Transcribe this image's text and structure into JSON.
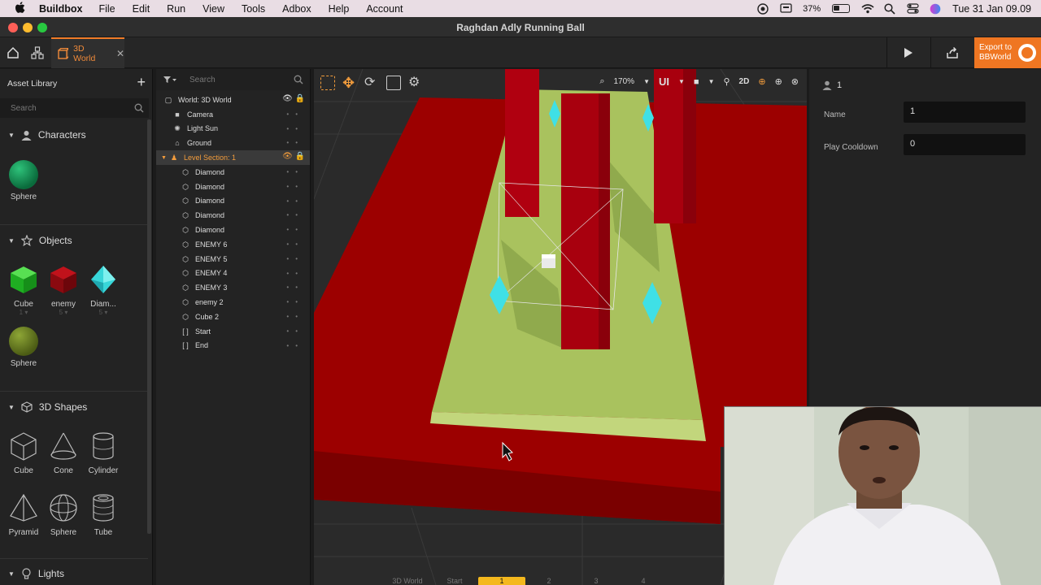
{
  "menubar": {
    "app_name": "Buildbox",
    "items": [
      "File",
      "Edit",
      "Run",
      "View",
      "Tools",
      "Adbox",
      "Help",
      "Account"
    ],
    "battery": "37%",
    "clock": "Tue 31 Jan  09.09"
  },
  "window": {
    "title": "Raghdan Adly Running Ball"
  },
  "toolbar": {
    "tab_label": "3D World",
    "export_label_1": "Export to",
    "export_label_2": "BBWorld"
  },
  "asset_library": {
    "title": "Asset Library",
    "search_placeholder": "Search",
    "sections": {
      "characters": {
        "title": "Characters",
        "items": [
          {
            "label": "Sphere"
          }
        ]
      },
      "objects": {
        "title": "Objects",
        "items": [
          {
            "label": "Cube",
            "count": "1"
          },
          {
            "label": "enemy",
            "count": "5"
          },
          {
            "label": "Diam...",
            "count": "5"
          },
          {
            "label": "Sphere"
          }
        ]
      },
      "shapes": {
        "title": "3D Shapes",
        "items": [
          {
            "label": "Cube"
          },
          {
            "label": "Cone"
          },
          {
            "label": "Cylinder"
          },
          {
            "label": "Pyramid"
          },
          {
            "label": "Sphere"
          },
          {
            "label": "Tube"
          }
        ]
      },
      "lights": {
        "title": "Lights"
      }
    }
  },
  "scene_tree": {
    "search_placeholder": "Search",
    "rows": [
      {
        "label": "World: 3D World"
      },
      {
        "label": "Camera"
      },
      {
        "label": "Light Sun"
      },
      {
        "label": "Ground"
      },
      {
        "label": "Level Section: 1"
      },
      {
        "label": "Diamond"
      },
      {
        "label": "Diamond"
      },
      {
        "label": "Diamond"
      },
      {
        "label": "Diamond"
      },
      {
        "label": "Diamond"
      },
      {
        "label": "ENEMY 6"
      },
      {
        "label": "ENEMY 5"
      },
      {
        "label": "ENEMY 4"
      },
      {
        "label": "ENEMY 3"
      },
      {
        "label": "enemy 2"
      },
      {
        "label": "Cube 2"
      },
      {
        "label": "Start"
      },
      {
        "label": "End"
      }
    ]
  },
  "viewport": {
    "zoom": "170%",
    "ui_label": "UI",
    "mode_2d": "2D",
    "bottom_tabs": [
      "3D World",
      "Start",
      "1",
      "2",
      "3",
      "4"
    ]
  },
  "properties": {
    "header": "1",
    "name_label": "Name",
    "name_value": "1",
    "cooldown_label": "Play Cooldown",
    "cooldown_value": "0"
  },
  "colors": {
    "accent": "#ef7622",
    "ground_red": "#9c0000",
    "grass": "#a9c25e",
    "diamond": "#3fe0e6"
  }
}
